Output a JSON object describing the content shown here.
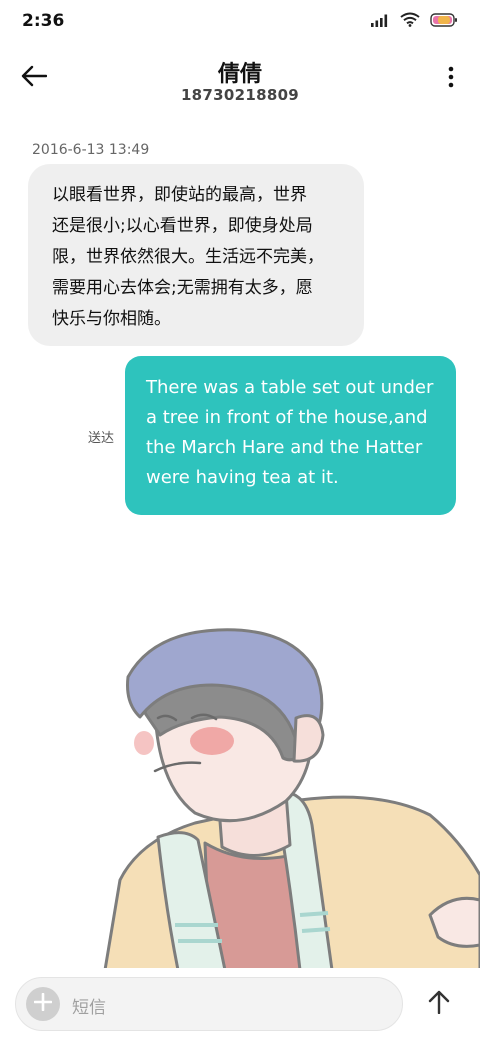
{
  "status_bar": {
    "time": "2:36",
    "icons": [
      "signal-icon",
      "wifi-icon",
      "battery-icon"
    ]
  },
  "header": {
    "title": "倩倩",
    "phone": "18730218809",
    "back_icon": "back-arrow-icon",
    "more_icon": "more-vertical-icon"
  },
  "conversation": {
    "timestamp": "2016-6-13 13:49",
    "incoming": {
      "lines": [
        "以眼看世界，即使站的最高，世界",
        "还是很小;以心看世界，即使身处局",
        "限，世界依然很大。生活远不完美，",
        "需要用心去体会;无需拥有太多，愿",
        "快乐与你相随。"
      ]
    },
    "outgoing": {
      "status": "送达",
      "lines": [
        "There was a table set out under",
        "a tree in front of the house,and",
        "the March Hare and the Hatter",
        "were having tea at it."
      ]
    }
  },
  "composer": {
    "placeholder": "短信",
    "add_icon": "plus-icon",
    "send_icon": "arrow-up-icon"
  },
  "colors": {
    "incoming_bubble": "#efefef",
    "outgoing_bubble": "#2ec3bd",
    "background": "#ffffff"
  }
}
